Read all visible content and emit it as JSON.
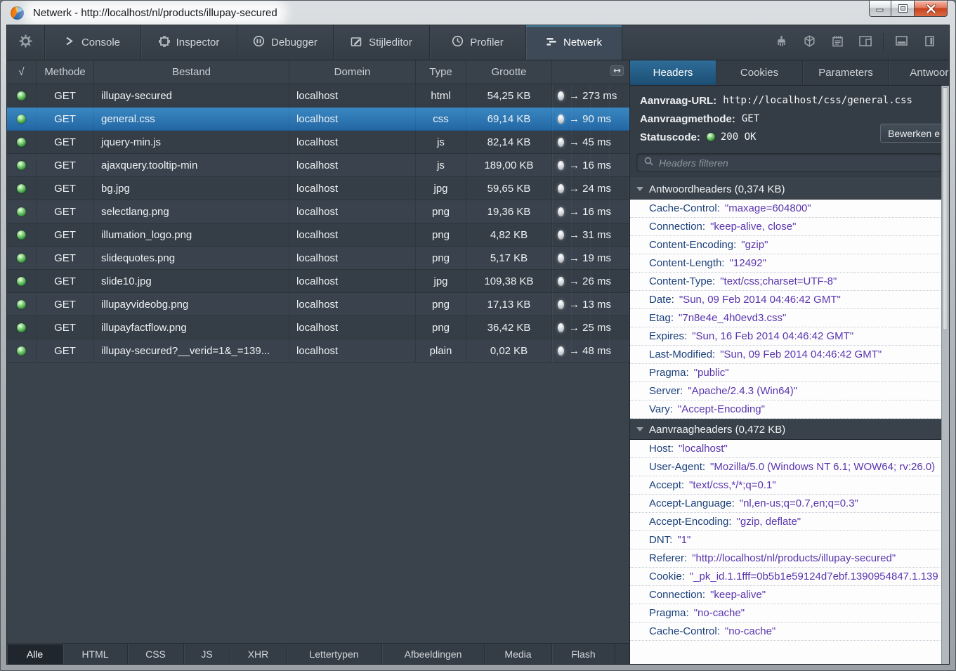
{
  "window": {
    "title": "Netwerk - http://localhost/nl/products/illupay-secured",
    "controls": [
      "minimize",
      "maximize",
      "close"
    ]
  },
  "toolbar": {
    "tabs": [
      {
        "id": "console",
        "label": "Console",
        "active": false
      },
      {
        "id": "inspector",
        "label": "Inspector",
        "active": false
      },
      {
        "id": "debugger",
        "label": "Debugger",
        "active": false
      },
      {
        "id": "styleeditor",
        "label": "Stijleditor",
        "active": false
      },
      {
        "id": "profiler",
        "label": "Profiler",
        "active": false
      },
      {
        "id": "network",
        "label": "Netwerk",
        "active": true
      }
    ],
    "actions": [
      "paint-flashing-icon",
      "3d-view-icon",
      "scratchpad-icon",
      "responsive-mode-icon",
      "dock-bottom-icon",
      "dock-sidebar-icon"
    ]
  },
  "request_table": {
    "columns": [
      {
        "key": "status",
        "label": "√"
      },
      {
        "key": "method",
        "label": "Methode"
      },
      {
        "key": "file",
        "label": "Bestand"
      },
      {
        "key": "domain",
        "label": "Domein"
      },
      {
        "key": "type",
        "label": "Type"
      },
      {
        "key": "size",
        "label": "Grootte"
      },
      {
        "key": "timeline",
        "label": "",
        "icon": "timeline-toggle-icon"
      }
    ],
    "rows": [
      {
        "method": "GET",
        "file": "illupay-secured",
        "domain": "localhost",
        "type": "html",
        "size": "54,25 KB",
        "time": "→ 273 ms",
        "selected": false
      },
      {
        "method": "GET",
        "file": "general.css",
        "domain": "localhost",
        "type": "css",
        "size": "69,14 KB",
        "time": "→ 90 ms",
        "selected": true
      },
      {
        "method": "GET",
        "file": "jquery-min.js",
        "domain": "localhost",
        "type": "js",
        "size": "82,14 KB",
        "time": "→ 45 ms",
        "selected": false
      },
      {
        "method": "GET",
        "file": "ajaxquery.tooltip-min",
        "domain": "localhost",
        "type": "js",
        "size": "189,00 KB",
        "time": "→ 16 ms",
        "selected": false
      },
      {
        "method": "GET",
        "file": "bg.jpg",
        "domain": "localhost",
        "type": "jpg",
        "size": "59,65 KB",
        "time": "→ 24 ms",
        "selected": false
      },
      {
        "method": "GET",
        "file": "selectlang.png",
        "domain": "localhost",
        "type": "png",
        "size": "19,36 KB",
        "time": "→ 16 ms",
        "selected": false
      },
      {
        "method": "GET",
        "file": "illumation_logo.png",
        "domain": "localhost",
        "type": "png",
        "size": "4,82 KB",
        "time": "→ 31 ms",
        "selected": false
      },
      {
        "method": "GET",
        "file": "slidequotes.png",
        "domain": "localhost",
        "type": "png",
        "size": "5,17 KB",
        "time": "→ 19 ms",
        "selected": false
      },
      {
        "method": "GET",
        "file": "slide10.jpg",
        "domain": "localhost",
        "type": "jpg",
        "size": "109,38 KB",
        "time": "→ 26 ms",
        "selected": false
      },
      {
        "method": "GET",
        "file": "illupayvideobg.png",
        "domain": "localhost",
        "type": "png",
        "size": "17,13 KB",
        "time": "→ 13 ms",
        "selected": false
      },
      {
        "method": "GET",
        "file": "illupayfactflow.png",
        "domain": "localhost",
        "type": "png",
        "size": "36,42 KB",
        "time": "→ 25 ms",
        "selected": false
      },
      {
        "method": "GET",
        "file": "illupay-secured?__verid=1&_=139...",
        "domain": "localhost",
        "type": "plain",
        "size": "0,02 KB",
        "time": "→ 48 ms",
        "selected": false
      }
    ]
  },
  "details_panel": {
    "tabs": [
      {
        "label": "Headers",
        "active": true
      },
      {
        "label": "Cookies",
        "active": false
      },
      {
        "label": "Parameters",
        "active": false
      },
      {
        "label": "Antwoord",
        "active": false
      }
    ],
    "summary": {
      "url_label": "Aanvraag-URL:",
      "url_value": "http://localhost/css/general.css",
      "method_label": "Aanvraagmethode:",
      "method_value": "GET",
      "status_label": "Statuscode:",
      "status_value": "200 OK",
      "edit_button_label": "Bewerken e"
    },
    "filter_placeholder": "Headers filteren",
    "sections": [
      {
        "title": "Antwoordheaders (0,374 KB)",
        "headers": [
          {
            "name": "Cache-Control:",
            "value": "\"maxage=604800\""
          },
          {
            "name": "Connection:",
            "value": "\"keep-alive, close\""
          },
          {
            "name": "Content-Encoding:",
            "value": "\"gzip\""
          },
          {
            "name": "Content-Length:",
            "value": "\"12492\""
          },
          {
            "name": "Content-Type:",
            "value": "\"text/css;charset=UTF-8\""
          },
          {
            "name": "Date:",
            "value": "\"Sun, 09 Feb 2014 04:46:42 GMT\""
          },
          {
            "name": "Etag:",
            "value": "\"7n8e4e_4h0evd3.css\""
          },
          {
            "name": "Expires:",
            "value": "\"Sun, 16 Feb 2014 04:46:42 GMT\""
          },
          {
            "name": "Last-Modified:",
            "value": "\"Sun, 09 Feb 2014 04:46:42 GMT\""
          },
          {
            "name": "Pragma:",
            "value": "\"public\""
          },
          {
            "name": "Server:",
            "value": "\"Apache/2.4.3 (Win64)\""
          },
          {
            "name": "Vary:",
            "value": "\"Accept-Encoding\""
          }
        ]
      },
      {
        "title": "Aanvraagheaders (0,472 KB)",
        "headers": [
          {
            "name": "Host:",
            "value": "\"localhost\""
          },
          {
            "name": "User-Agent:",
            "value": "\"Mozilla/5.0 (Windows NT 6.1; WOW64; rv:26.0)"
          },
          {
            "name": "Accept:",
            "value": "\"text/css,*/*;q=0.1\""
          },
          {
            "name": "Accept-Language:",
            "value": "\"nl,en-us;q=0.7,en;q=0.3\""
          },
          {
            "name": "Accept-Encoding:",
            "value": "\"gzip, deflate\""
          },
          {
            "name": "DNT:",
            "value": "\"1\""
          },
          {
            "name": "Referer:",
            "value": "\"http://localhost/nl/products/illupay-secured\""
          },
          {
            "name": "Cookie:",
            "value": "\"_pk_id.1.1fff=0b5b1e59124d7ebf.1390954847.1.139"
          },
          {
            "name": "Connection:",
            "value": "\"keep-alive\""
          },
          {
            "name": "Pragma:",
            "value": "\"no-cache\""
          },
          {
            "name": "Cache-Control:",
            "value": "\"no-cache\""
          }
        ]
      }
    ]
  },
  "filter_bar": {
    "items": [
      {
        "label": "Alle",
        "active": true
      },
      {
        "label": "HTML",
        "active": false
      },
      {
        "label": "CSS",
        "active": false
      },
      {
        "label": "JS",
        "active": false
      },
      {
        "label": "XHR",
        "active": false
      },
      {
        "label": "Lettertypen",
        "active": false
      },
      {
        "label": "Afbeeldingen",
        "active": false
      },
      {
        "label": "Media",
        "active": false
      },
      {
        "label": "Flash",
        "active": false
      }
    ]
  },
  "colors": {
    "selection_blue": "#2e79b4",
    "active_header_tab": "#2d6d99",
    "status_ok_green": "#44a348",
    "header_name_blue": "#1b4079",
    "header_value_purple": "#5a35ad",
    "close_button_red": "#c9431f",
    "panel_dark": "#343c45"
  }
}
